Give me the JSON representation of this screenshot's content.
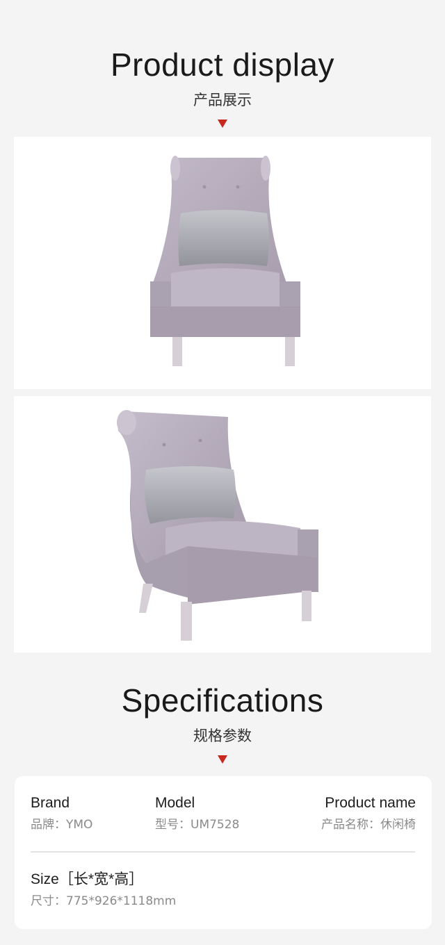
{
  "display": {
    "title_en": "Product display",
    "title_cn": "产品展示"
  },
  "specs": {
    "title_en": "Specifications",
    "title_cn": "规格参数",
    "brand_label": "Brand",
    "brand_value": "品牌：YMO",
    "model_label": "Model",
    "model_value": "型号：UM7528",
    "name_label": "Product name",
    "name_value": "产品名称：休闲椅",
    "size_label": "Size［长*宽*高］",
    "size_value": "尺寸：775*926*1118mm"
  },
  "colors": {
    "accent": "#c8281e",
    "fabric": "#b7adbd",
    "pillow": "#a9aab0",
    "leg": "#d6cfd5"
  },
  "images": [
    "chair-front-photo",
    "chair-angle-photo"
  ]
}
